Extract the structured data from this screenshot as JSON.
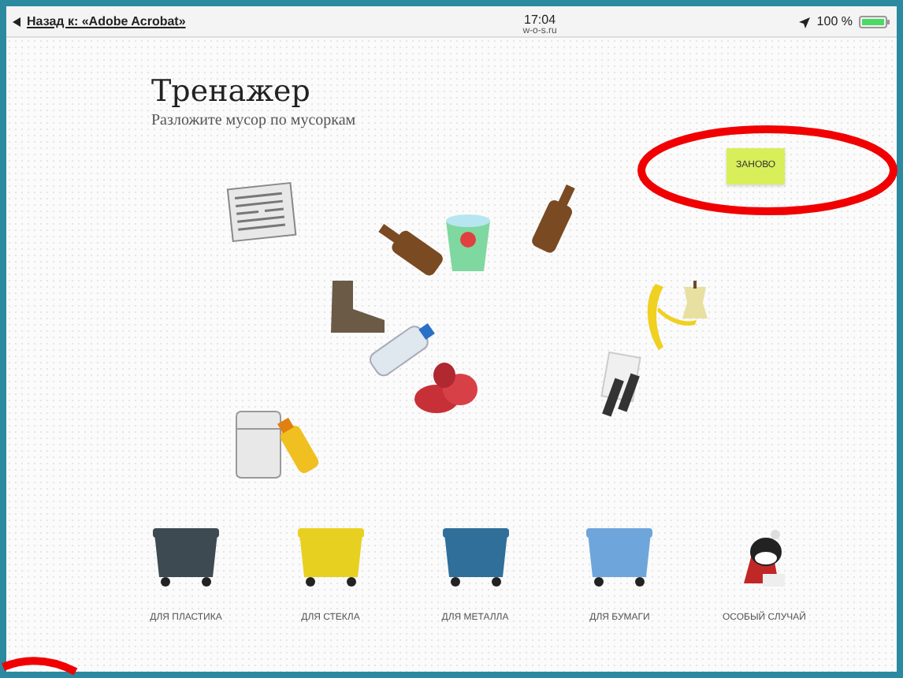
{
  "status_bar": {
    "back_link": "Назад к: «Adobe Acrobat»",
    "time": "17:04",
    "url": "w-o-s.ru",
    "battery": "100 %"
  },
  "page": {
    "title": "Тренажер",
    "subtitle": "Разложите мусор по мусоркам",
    "restart_button": "ЗАНОВО"
  },
  "bins": [
    {
      "kind": "bin",
      "label": "ДЛЯ ПЛАСТИКА",
      "color": "#3d4a52"
    },
    {
      "kind": "bin",
      "label": "ДЛЯ СТЕКЛА",
      "color": "#e8d020"
    },
    {
      "kind": "bin",
      "label": "ДЛЯ МЕТАЛЛА",
      "color": "#2f6f9a"
    },
    {
      "kind": "bin",
      "label": "ДЛЯ БУМАГИ",
      "color": "#6ea6dc"
    },
    {
      "kind": "mascot",
      "label": "ОСОБЫЙ СЛУЧАЙ"
    }
  ]
}
